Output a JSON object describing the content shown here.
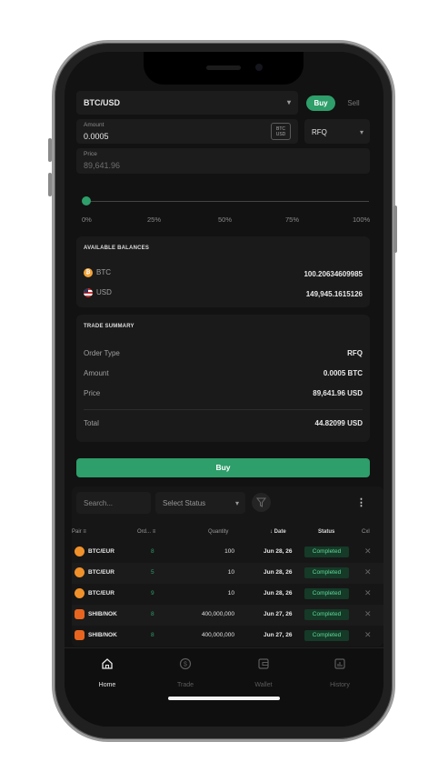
{
  "trade_form": {
    "pair": "BTC/USD",
    "buy_label": "Buy",
    "sell_label": "Sell",
    "amount_label": "Amount",
    "amount_value": "0.0005",
    "unit_top": "BTC",
    "unit_bottom": "USD",
    "order_type": "RFQ",
    "price_label": "Price",
    "price_value": "89,641.96",
    "slider_percent": 0,
    "slider_ticks": [
      "0%",
      "25%",
      "50%",
      "75%",
      "100%"
    ]
  },
  "balances": {
    "title": "AVAILABLE BALANCES",
    "items": [
      {
        "currency": "BTC",
        "amount": "100.20634609985"
      },
      {
        "currency": "USD",
        "amount": "149,945.1615126"
      }
    ]
  },
  "summary": {
    "title": "TRADE SUMMARY",
    "order_type_label": "Order Type",
    "order_type_value": "RFQ",
    "amount_label": "Amount",
    "amount_value": "0.0005 BTC",
    "price_label": "Price",
    "price_value": "89,641.96 USD",
    "total_label": "Total",
    "total_value": "44.82099 USD"
  },
  "buy_button": "Buy",
  "orders": {
    "search_placeholder": "Search...",
    "status_filter": "Select Status",
    "columns": {
      "pair": "Pair",
      "order": "Ord...",
      "quantity": "Quantity",
      "date": "Date",
      "status": "Status",
      "cut": "Cxl"
    },
    "rows": [
      {
        "pair": "BTC/EUR",
        "order": "8",
        "quantity": "100",
        "date": "Jun 28, 26",
        "status": "Completed",
        "coin": "btc"
      },
      {
        "pair": "BTC/EUR",
        "order": "5",
        "quantity": "10",
        "date": "Jun 28, 26",
        "status": "Completed",
        "coin": "btc"
      },
      {
        "pair": "BTC/EUR",
        "order": "9",
        "quantity": "10",
        "date": "Jun 28, 26",
        "status": "Completed",
        "coin": "btc"
      },
      {
        "pair": "SHIB/NOK",
        "order": "8",
        "quantity": "400,000,000",
        "date": "Jun 27, 26",
        "status": "Completed",
        "coin": "shib"
      },
      {
        "pair": "SHIB/NOK",
        "order": "8",
        "quantity": "400,000,000",
        "date": "Jun 27, 26",
        "status": "Completed",
        "coin": "shib"
      }
    ]
  },
  "tabs": [
    {
      "label": "Home",
      "icon": "home-icon",
      "active": true
    },
    {
      "label": "Trade",
      "icon": "dollar-circle-icon",
      "active": false
    },
    {
      "label": "Wallet",
      "icon": "wallet-icon",
      "active": false
    },
    {
      "label": "History",
      "icon": "chart-icon",
      "active": false
    }
  ],
  "colors": {
    "accent": "#2e9e6a",
    "background": "#121212",
    "badge_text": "#5fd89a"
  }
}
